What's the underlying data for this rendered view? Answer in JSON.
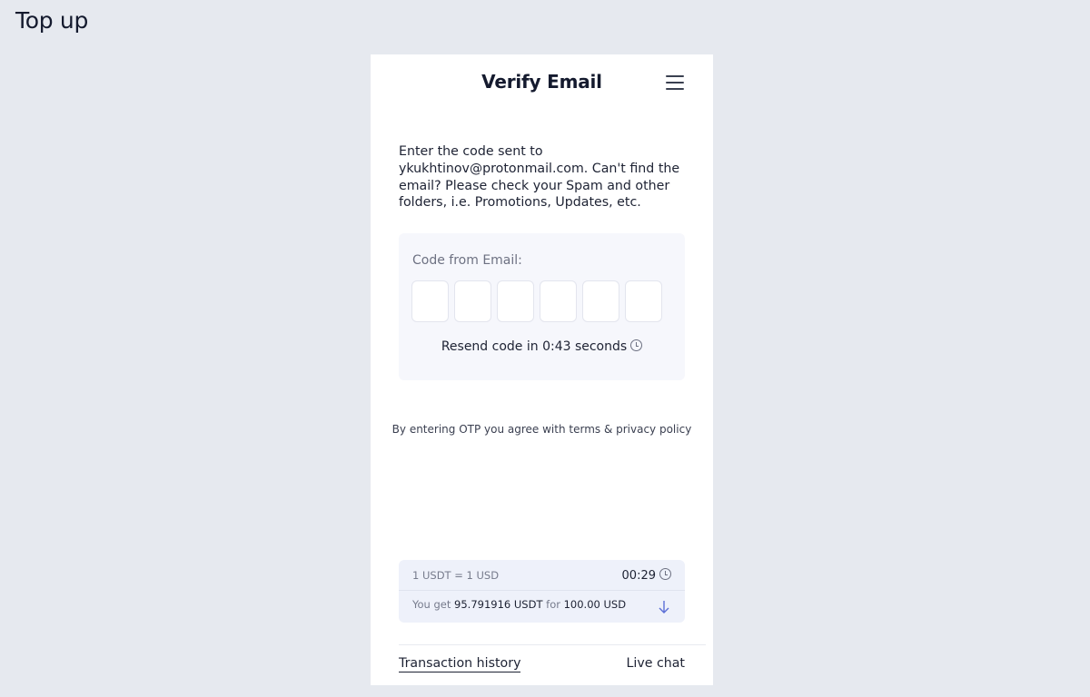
{
  "page": {
    "title": "Top up"
  },
  "header": {
    "title": "Verify Email",
    "menu_icon": "hamburger-menu-icon"
  },
  "instructions": "Enter the code sent to ykukhtinov@protonmail.com. Can't find the email? Please check your Spam and other folders, i.e. Promotions, Updates, etc.",
  "code_form": {
    "label": "Code from Email:",
    "digits": [
      "",
      "",
      "",
      "",
      "",
      ""
    ],
    "resend_text": "Resend code in 0:43 seconds",
    "resend_icon": "clock-icon"
  },
  "terms": "By entering OTP you agree with terms & privacy policy",
  "rate": {
    "rate_text": "1 USDT = 1 USD",
    "timer": "00:29",
    "timer_icon": "clock-icon",
    "you_get_prefix": "You get",
    "amount": "95.791916 USDT",
    "for_word": "for",
    "pay_amount": "100.00 USD",
    "expand_icon": "arrow-down-icon"
  },
  "footer": {
    "history": "Transaction history",
    "chat": "Live chat"
  },
  "colors": {
    "background": "#e6e9ef",
    "panel": "#f6f7fc",
    "rate_panel": "#eef1fa",
    "text": "#141a2e"
  }
}
